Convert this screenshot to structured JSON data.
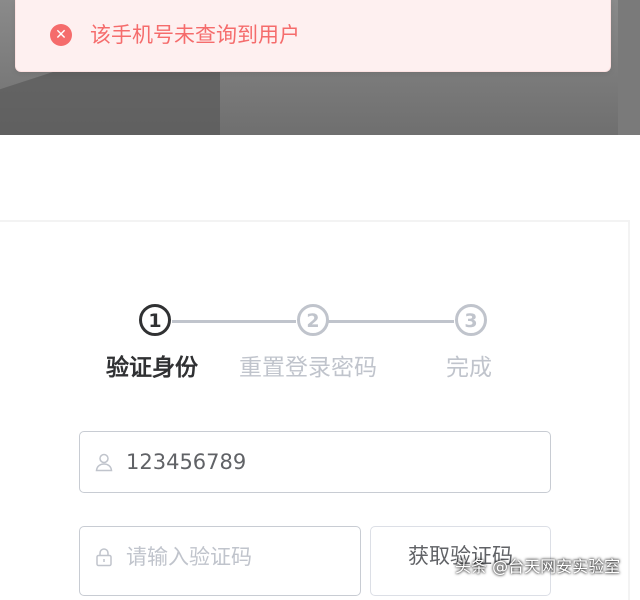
{
  "alert": {
    "type": "error",
    "message": "该手机号未查询到用户",
    "icon": "close-circle-icon",
    "color": "#f56c6c",
    "background": "#fef0f0"
  },
  "steps": [
    {
      "number": "1",
      "label": "验证身份",
      "status": "active"
    },
    {
      "number": "2",
      "label": "重置登录密码",
      "status": "pending"
    },
    {
      "number": "3",
      "label": "完成",
      "status": "pending"
    }
  ],
  "form": {
    "phone": {
      "value": "123456789",
      "icon": "user-icon"
    },
    "code": {
      "placeholder": "请输入验证码",
      "value": "",
      "icon": "lock-icon"
    },
    "get_code_button": "获取验证码"
  },
  "watermark": "头条 @台天网安实验室",
  "colors": {
    "active": "#303133",
    "inactive": "#c0c4cc",
    "border": "#c8ccd3"
  }
}
